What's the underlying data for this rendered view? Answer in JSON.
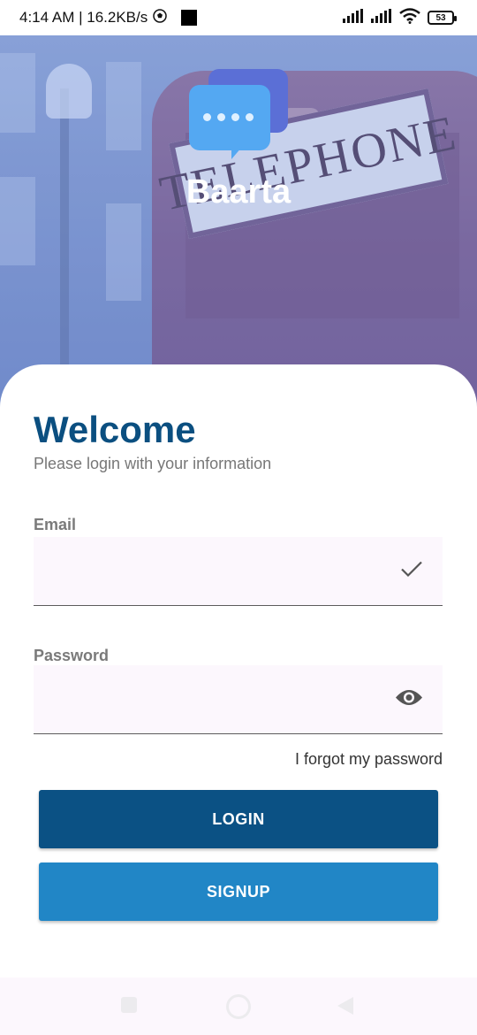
{
  "status_bar": {
    "time_speed": "4:14 AM | 16.2KB/s",
    "battery": "53",
    "icons": [
      "soccer-ball-icon",
      "black-square-icon",
      "signal-icon",
      "signal-icon",
      "wifi-icon",
      "battery-icon"
    ]
  },
  "hero": {
    "sign_text": "TELEPHONE",
    "app_name": "Baarta"
  },
  "login": {
    "title": "Welcome",
    "subtitle": "Please login with your information",
    "email_label": "Email",
    "email_value": "",
    "password_label": "Password",
    "password_value": "",
    "forgot_link": "I forgot my password",
    "login_button": "LOGIN",
    "signup_button": "SIGNUP"
  },
  "colors": {
    "primary": "#0b5184",
    "secondary": "#2186c6",
    "title": "#0b4f80",
    "field_bg": "#fcf7fd"
  },
  "nav_bar": {
    "icons": [
      "recents-square-icon",
      "home-circle-icon",
      "back-triangle-icon"
    ]
  }
}
